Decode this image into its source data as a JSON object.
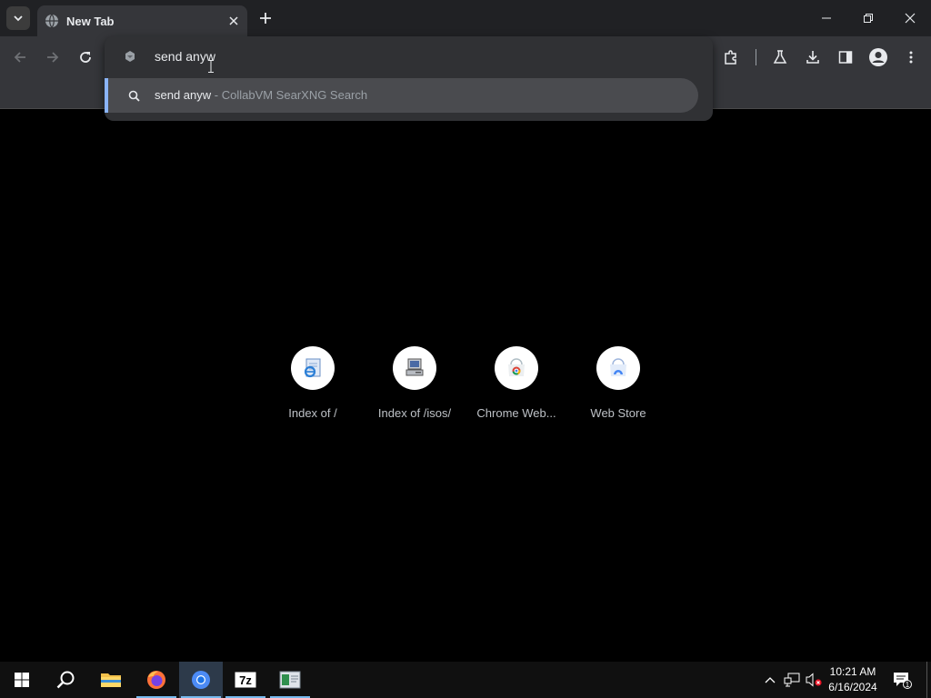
{
  "browser": {
    "tab_title": "New Tab",
    "omnibox_value": "send anyw",
    "suggestion": {
      "query": "send anyw",
      "separator": " - ",
      "engine": "CollabVM SearXNG Search"
    }
  },
  "shortcuts": [
    {
      "label": "Index of /",
      "icon": "ie-page-icon"
    },
    {
      "label": "Index of /isos/",
      "icon": "computer-icon"
    },
    {
      "label": "Chrome Web...",
      "icon": "chrome-web-store-icon"
    },
    {
      "label": "Web Store",
      "icon": "web-store-icon"
    }
  ],
  "taskbar": {
    "apps": [
      "start",
      "search",
      "file-explorer",
      "firefox",
      "chrome",
      "7zip",
      "other-app"
    ],
    "clock_time": "10:21 AM",
    "clock_date": "6/16/2024",
    "notification_count": "1"
  },
  "colors": {
    "accent": "#8ab4f8",
    "taskbar_active": "#76b9ed"
  }
}
